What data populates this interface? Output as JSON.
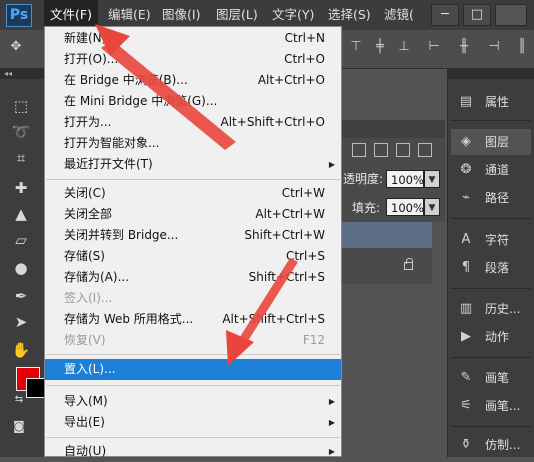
{
  "app": {
    "logo": "Ps"
  },
  "menubar": {
    "items": [
      "文件(F)",
      "编辑(E)",
      "图像(I)",
      "图层(L)",
      "文字(Y)",
      "选择(S)",
      "滤镜("
    ],
    "active_index": 0
  },
  "window_controls": {
    "minimize": "─",
    "maximize": "□"
  },
  "file_menu": {
    "items": [
      {
        "label": "新建(N)...",
        "shortcut": "Ctrl+N"
      },
      {
        "label": "打开(O)...",
        "shortcut": "Ctrl+O"
      },
      {
        "label": "在 Bridge 中浏览(B)...",
        "shortcut": "Alt+Ctrl+O"
      },
      {
        "label": "在 Mini Bridge 中浏览(G)...",
        "shortcut": ""
      },
      {
        "label": "打开为...",
        "shortcut": "Alt+Shift+Ctrl+O"
      },
      {
        "label": "打开为智能对象...",
        "shortcut": ""
      },
      {
        "label": "最近打开文件(T)",
        "shortcut": "",
        "submenu": true
      },
      {
        "label": "关闭(C)",
        "shortcut": "Ctrl+W"
      },
      {
        "label": "关闭全部",
        "shortcut": "Alt+Ctrl+W"
      },
      {
        "label": "关闭并转到 Bridge...",
        "shortcut": "Shift+Ctrl+W"
      },
      {
        "label": "存储(S)",
        "shortcut": "Ctrl+S"
      },
      {
        "label": "存储为(A)...",
        "shortcut": "Shift+Ctrl+S"
      },
      {
        "label": "签入(I)...",
        "shortcut": "",
        "disabled": true
      },
      {
        "label": "存储为 Web 所用格式...",
        "shortcut": "Alt+Shift+Ctrl+S"
      },
      {
        "label": "恢复(V)",
        "shortcut": "F12",
        "disabled": true
      },
      {
        "label": "置入(L)...",
        "shortcut": "",
        "highlighted": true
      },
      {
        "label": "导入(M)",
        "shortcut": "",
        "submenu": true
      },
      {
        "label": "导出(E)",
        "shortcut": "",
        "submenu": true
      },
      {
        "label": "自动(U)",
        "shortcut": "",
        "submenu": true
      }
    ],
    "submenu_arrow": "▶"
  },
  "layers_panel": {
    "opacity_label": "透明度:",
    "opacity_value": "100%",
    "fill_label": "填充:",
    "fill_value": "100%"
  },
  "right_panels": [
    {
      "label": "属性",
      "icon": "properties-icon"
    },
    {
      "label": "图层",
      "icon": "layers-icon",
      "selected": true
    },
    {
      "label": "通道",
      "icon": "channels-icon"
    },
    {
      "label": "路径",
      "icon": "paths-icon"
    },
    {
      "label": "字符",
      "icon": "character-icon"
    },
    {
      "label": "段落",
      "icon": "paragraph-icon"
    },
    {
      "label": "历史...",
      "icon": "history-icon"
    },
    {
      "label": "动作",
      "icon": "actions-icon"
    },
    {
      "label": "画笔",
      "icon": "brush-icon"
    },
    {
      "label": "画笔...",
      "icon": "brush-presets-icon"
    },
    {
      "label": "仿制...",
      "icon": "clone-source-icon"
    }
  ],
  "colors": {
    "foreground": "#e0000a",
    "background": "#000000",
    "highlight": "#1e7fd8",
    "arrow": "#e8463c"
  }
}
